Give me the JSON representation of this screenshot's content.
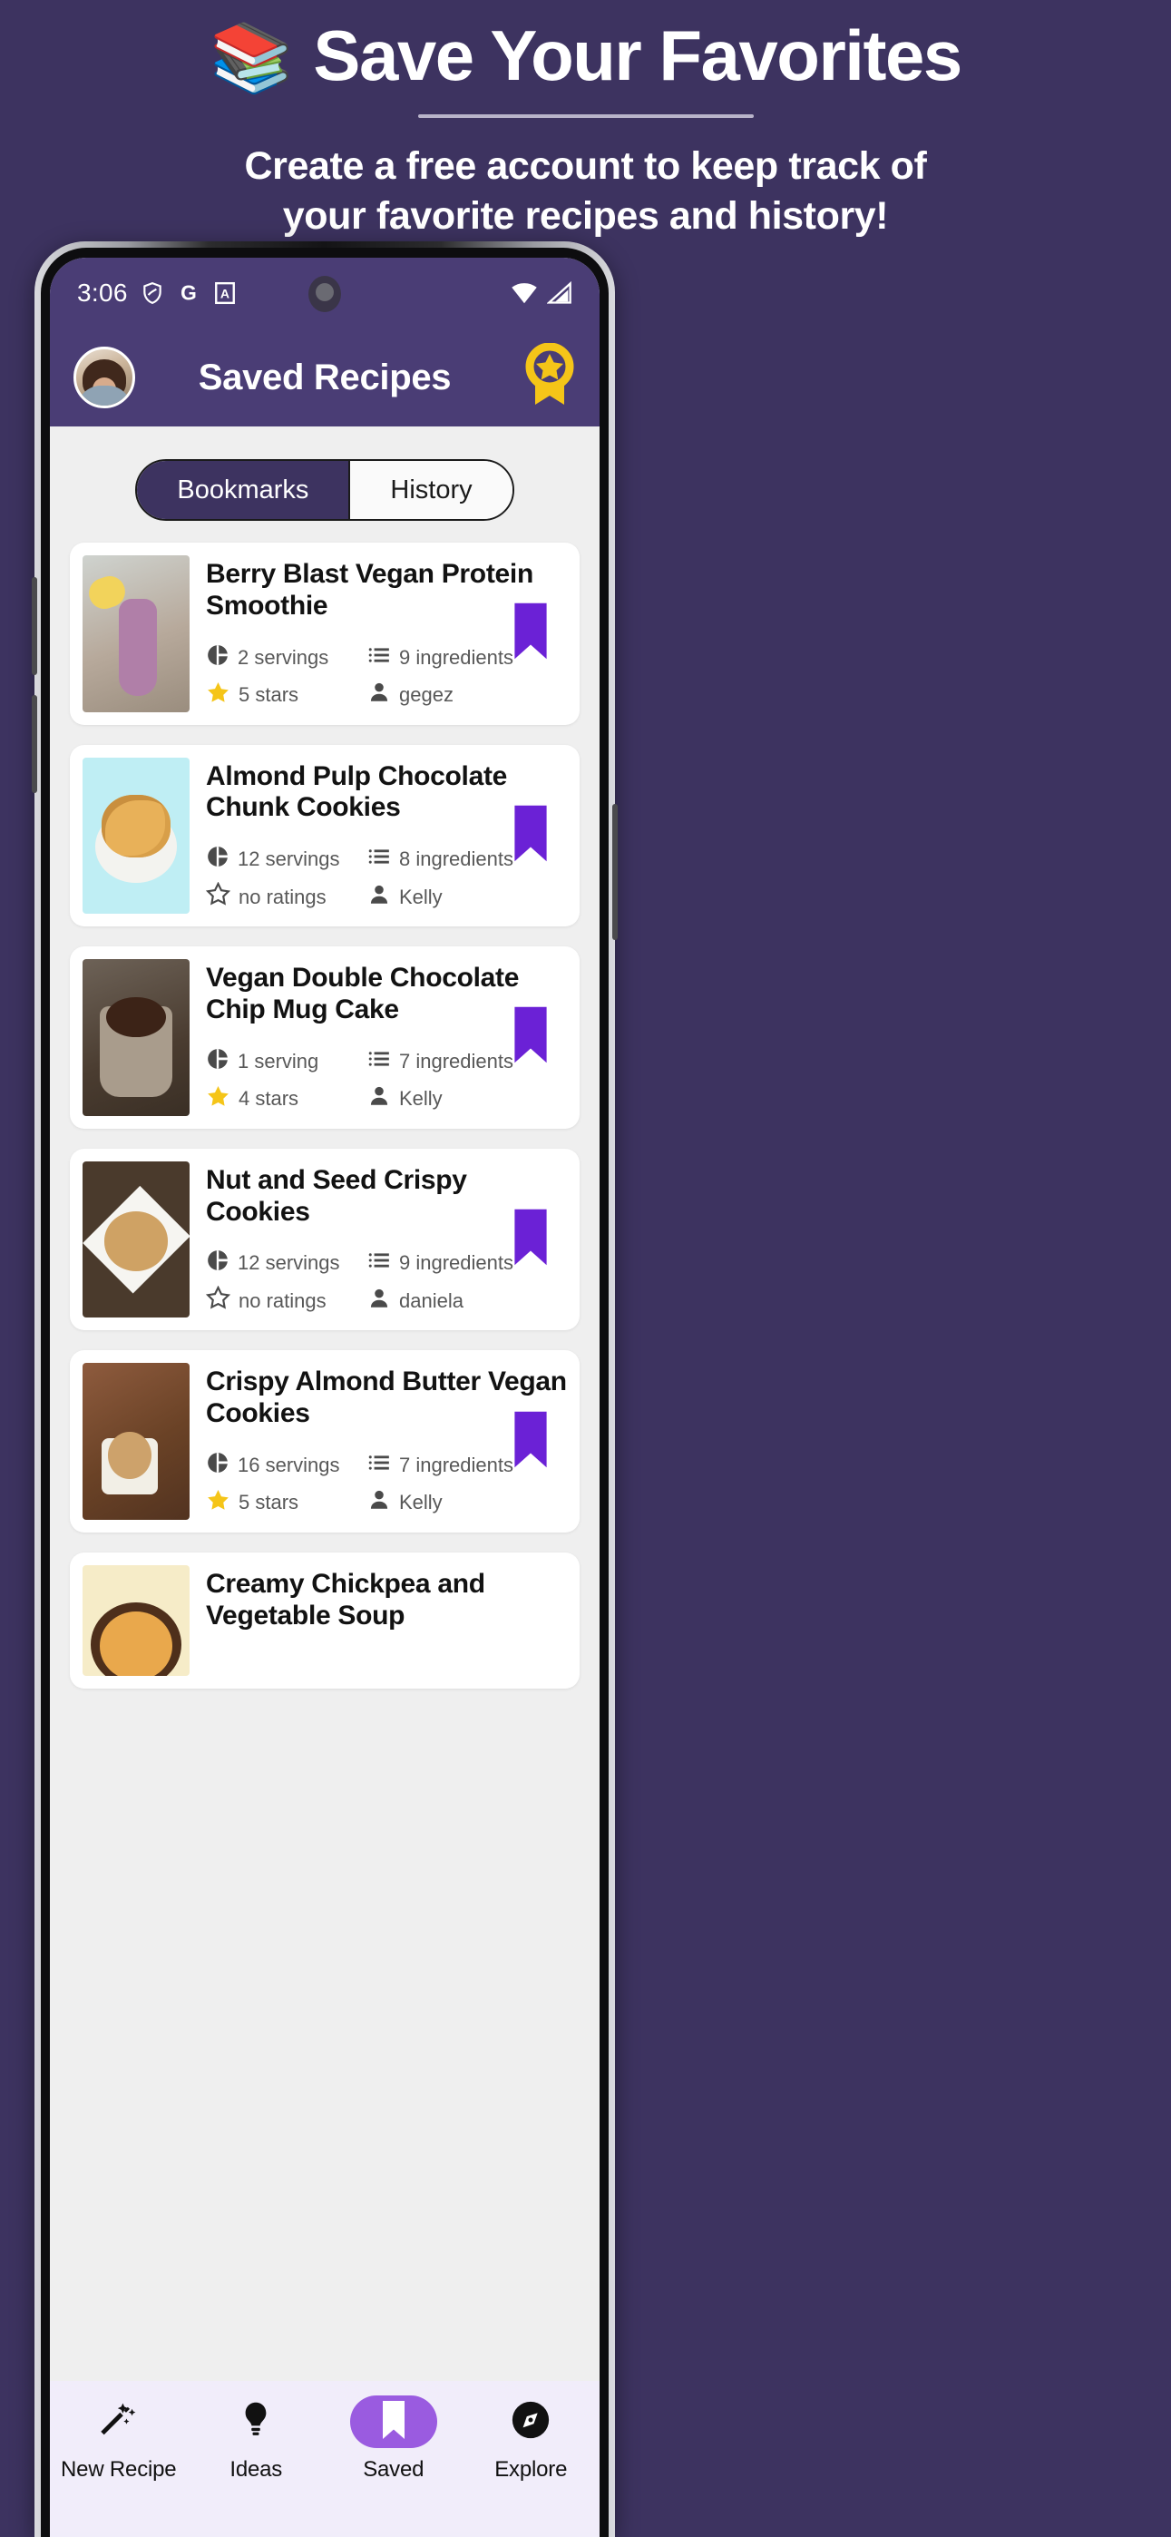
{
  "promo": {
    "icon": "books-emoji",
    "icon_glyph": "📚",
    "title": "Save Your Favorites",
    "subtitle_line1": "Create a free account to keep track of",
    "subtitle_line2": "your favorite recipes and history!",
    "background_color": "#3D3360",
    "text_color": "#FFFFFF"
  },
  "statusbar": {
    "time": "3:06",
    "icons": [
      "shield-icon",
      "google-icon",
      "a-badge-icon"
    ],
    "google_glyph": "G",
    "a_glyph": "A",
    "right_icons": [
      "wifi-icon",
      "cell-signal-icon"
    ]
  },
  "appbar": {
    "title": "Saved Recipes",
    "avatar_name": "user-avatar",
    "award_icon": "award-ribbon-icon",
    "background_color": "#4A3D75",
    "award_color": "#F5C518"
  },
  "tabs": {
    "items": [
      {
        "label": "Bookmarks",
        "active": true
      },
      {
        "label": "History",
        "active": false
      }
    ],
    "active_bg": "#3D3360"
  },
  "recipes": [
    {
      "title": "Berry Blast Vegan Protein Smoothie",
      "servings": "2 servings",
      "ingredients": "9 ingredients",
      "rating": "5 stars",
      "rating_type": "star-filled",
      "author": "gegez",
      "bookmarked": true,
      "thumb": "t-smoothie"
    },
    {
      "title": "Almond Pulp Chocolate Chunk Cookies",
      "servings": "12 servings",
      "ingredients": "8 ingredients",
      "rating": "no ratings",
      "rating_type": "star-outline",
      "author": "Kelly",
      "bookmarked": true,
      "thumb": "t-cookies-blue"
    },
    {
      "title": "Vegan Double Chocolate Chip Mug Cake",
      "servings": "1 serving",
      "ingredients": "7 ingredients",
      "rating": "4 stars",
      "rating_type": "star-filled",
      "author": "Kelly",
      "bookmarked": true,
      "thumb": "t-mugcake"
    },
    {
      "title": "Nut and Seed Crispy Cookies",
      "servings": "12 servings",
      "ingredients": "9 ingredients",
      "rating": "no ratings",
      "rating_type": "star-outline",
      "author": "daniela",
      "bookmarked": true,
      "thumb": "t-nutseed"
    },
    {
      "title": "Crispy Almond Butter Vegan Cookies",
      "servings": "16 servings",
      "ingredients": "7 ingredients",
      "rating": "5 stars",
      "rating_type": "star-filled",
      "author": "Kelly",
      "bookmarked": true,
      "thumb": "t-almondbutter"
    },
    {
      "title": "Creamy Chickpea and Vegetable Soup",
      "servings": "",
      "ingredients": "",
      "rating": "",
      "rating_type": "",
      "author": "",
      "bookmarked": false,
      "thumb": "t-soup"
    }
  ],
  "bottomnav": {
    "items": [
      {
        "label": "New Recipe",
        "icon": "magic-wand-icon",
        "active": false
      },
      {
        "label": "Ideas",
        "icon": "lightbulb-icon",
        "active": false
      },
      {
        "label": "Saved",
        "icon": "bookmark-icon",
        "active": true
      },
      {
        "label": "Explore",
        "icon": "compass-icon",
        "active": false
      }
    ],
    "active_color": "#9A5BE0",
    "background_color": "#F1EDFA"
  },
  "colors": {
    "brand_purple": "#3D3360",
    "appbar_purple": "#4A3D75",
    "bookmark_purple": "#6B21D6",
    "star_yellow": "#F5C518",
    "page_bg": "#EFEFEF"
  }
}
